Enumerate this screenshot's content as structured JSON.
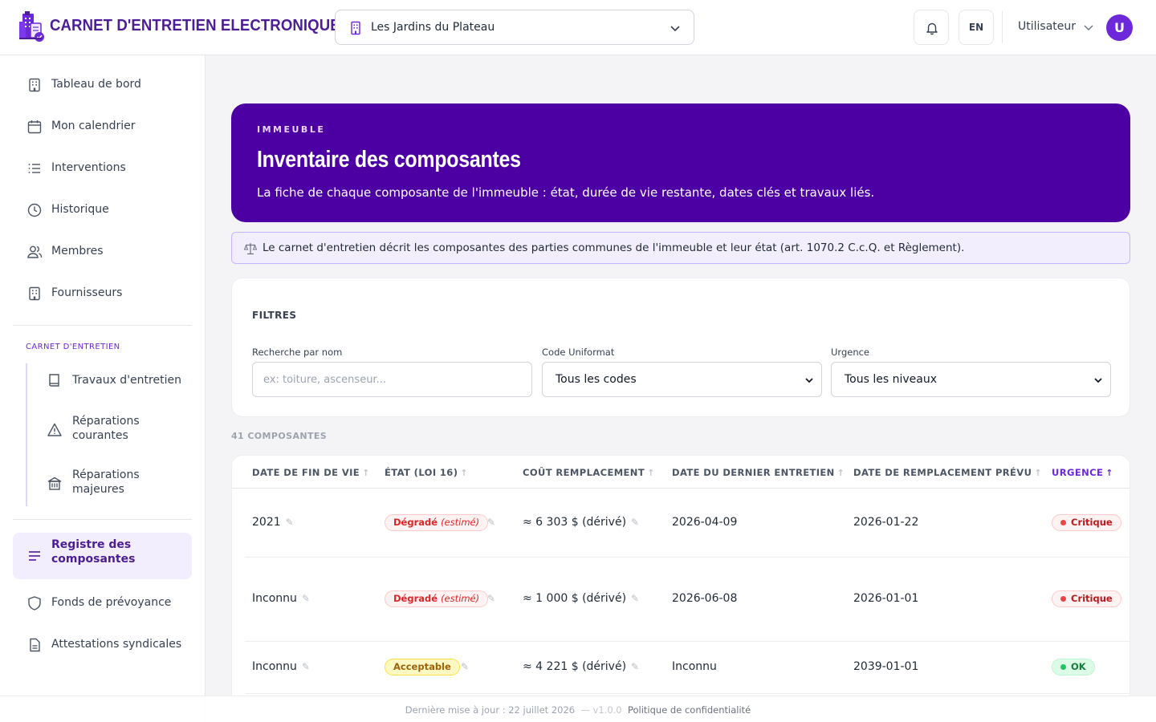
{
  "app": {
    "title": "CARNET D'ENTRETIEN ELECTRONIQUE"
  },
  "header": {
    "building": "Les Jardins du Plateau",
    "lang": "EN",
    "user": "Utilisateur",
    "avatar_initial": "U"
  },
  "sidebar": {
    "items": [
      {
        "label": "Tableau de bord",
        "icon": "building-icon"
      },
      {
        "label": "Mon calendrier",
        "icon": "calendar-icon"
      },
      {
        "label": "Interventions",
        "icon": "list-icon"
      },
      {
        "label": "Historique",
        "icon": "clock-icon"
      },
      {
        "label": "Membres",
        "icon": "users-icon"
      },
      {
        "label": "Fournisseurs",
        "icon": "building-icon"
      }
    ],
    "section": "CARNET D'ENTRETIEN",
    "sub_items": [
      {
        "label": "Travaux d'entretien",
        "icon": "book-icon"
      },
      {
        "label": "Réparations courantes",
        "icon": "warning-icon"
      },
      {
        "label": "Réparations majeures",
        "icon": "bank-icon"
      }
    ],
    "bottom_items": [
      {
        "label": "Registre des composantes",
        "icon": "lines-icon",
        "active": true
      },
      {
        "label": "Fonds de prévoyance",
        "icon": "shield-icon"
      },
      {
        "label": "Attestations syndicales",
        "icon": "document-icon"
      }
    ]
  },
  "hero": {
    "eyebrow": "IMMEUBLE",
    "title": "Inventaire des composantes",
    "description": "La fiche de chaque composante de l'immeuble : état, durée de vie restante, dates clés et travaux liés."
  },
  "notice": {
    "icon": "scale-icon",
    "text": "Le carnet d'entretien décrit les composantes des parties communes de l'immeuble et leur état (art. 1070.2 C.c.Q. et Règlement)."
  },
  "filters": {
    "title": "FILTRES",
    "search_label": "Recherche par nom",
    "search_placeholder": "ex: toiture, ascenseur...",
    "code_label": "Code Uniformat",
    "code_value": "Tous les codes",
    "urgency_label": "Urgence",
    "urgency_value": "Tous les niveaux"
  },
  "table": {
    "count": "41 COMPOSANTES",
    "columns": [
      "DATE DE FIN DE VIE",
      "ÉTAT (LOI 16)",
      "COÛT REMPLACEMENT",
      "DATE DU DERNIER ENTRETIEN",
      "DATE DE REMPLACEMENT PRÉVU",
      "URGENCE"
    ],
    "sort_column": "URGENCE",
    "rows": [
      {
        "end_of_life": "2021",
        "state": "Dégradé",
        "state_note": "(estimé)",
        "state_kind": "degrade",
        "cost": "≈ 6 303 $ (dérivé)",
        "last_maintenance": "2026-04-09",
        "planned_replacement": "2026-01-22",
        "urgency": "Critique",
        "urgency_kind": "critique"
      },
      {
        "end_of_life": "Inconnu",
        "state": "Dégradé",
        "state_note": "(estimé)",
        "state_kind": "degrade",
        "cost": "≈ 1 000 $ (dérivé)",
        "last_maintenance": "2026-06-08",
        "planned_replacement": "2026-01-01",
        "urgency": "Critique",
        "urgency_kind": "critique"
      },
      {
        "end_of_life": "Inconnu",
        "state": "Acceptable",
        "state_note": "",
        "state_kind": "accept",
        "cost": "≈ 4 221 $ (dérivé)",
        "last_maintenance": "Inconnu",
        "planned_replacement": "2039-01-01",
        "urgency": "OK",
        "urgency_kind": "ok"
      }
    ]
  },
  "footer": {
    "updated": "Dernière mise à jour : 22 juillet 2026",
    "version": "— v1.0.0",
    "privacy": "Politique de confidentialité"
  },
  "colors": {
    "brand": "#4c00a4",
    "accent": "#6d28d9"
  }
}
